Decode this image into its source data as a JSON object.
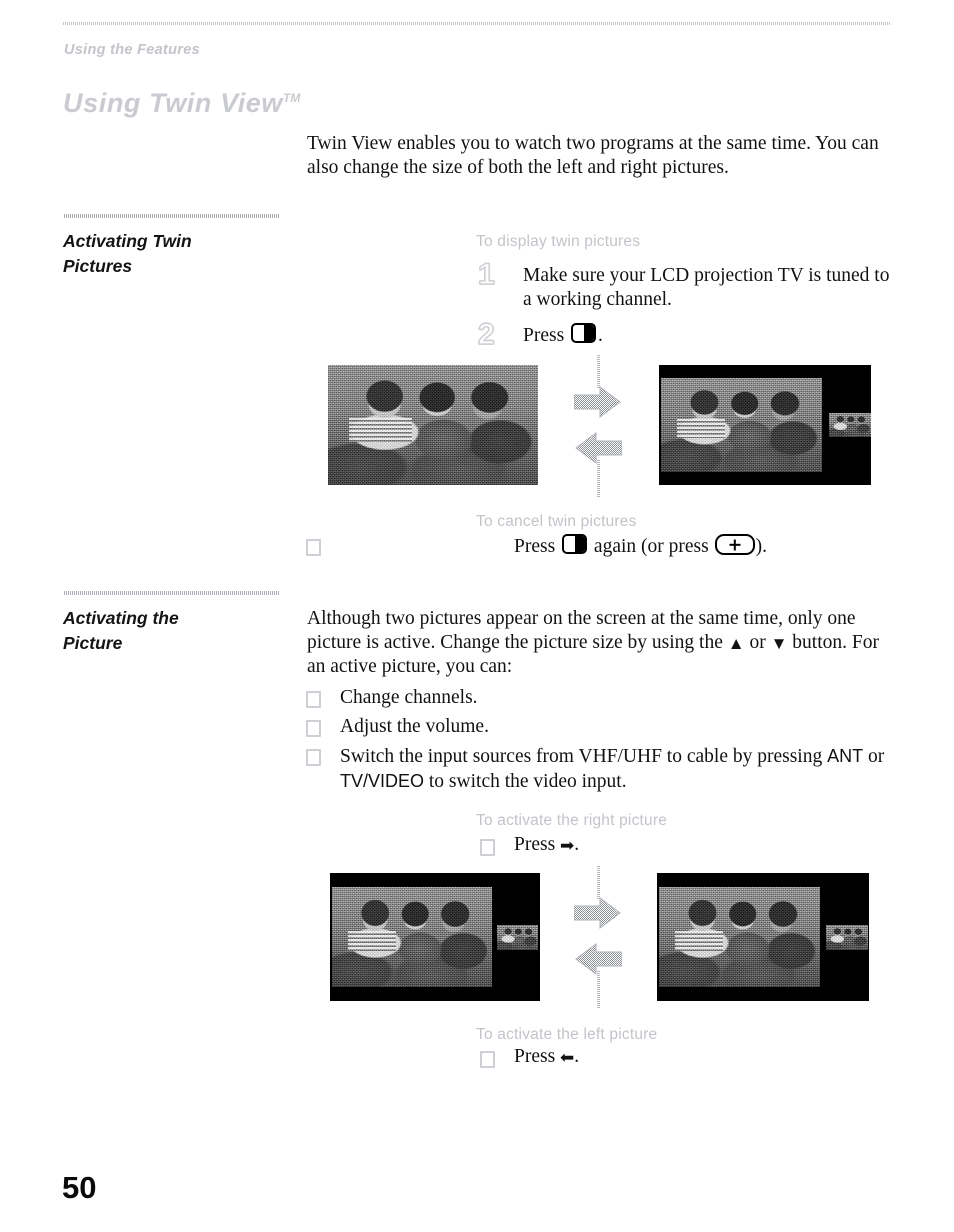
{
  "header": {
    "running_head": "Using the Features",
    "chapter_title": "Using Twin View",
    "trademark": "TM"
  },
  "intro": {
    "paragraph": "Twin View enables you to watch two programs at the same time. You can also change the size of both the left and right pictures."
  },
  "sections": [
    {
      "label_line1": "Activating Twin",
      "label_line2": "Pictures",
      "subhead_display": "To display twin pictures",
      "steps": [
        {
          "number": "1",
          "text": "Make sure your LCD projection TV is tuned to a working channel."
        },
        {
          "number": "2",
          "text_before": "Press",
          "text_after": "."
        }
      ],
      "subhead_cancel": "To cancel twin pictures",
      "cancel_bullet": {
        "text_before": "Press",
        "text_middle": "again (or press",
        "text_after": ")."
      }
    },
    {
      "label_line1": "Activating the",
      "label_line2": "Picture",
      "paragraph_1": "Although two pictures appear on the screen at the same time, only one",
      "paragraph_2_a": "picture is active. Change the picture size by using the",
      "paragraph_2_or": "or",
      "paragraph_2_b": "button. For an",
      "paragraph_3": "active picture, you can:",
      "bullets": [
        {
          "text": "Change channels."
        },
        {
          "text": "Adjust the volume."
        }
      ],
      "bullet_switch": {
        "part_1": "Switch the input sources from VHF/UHF to cable by pressing",
        "ant": "ANT",
        "part_2": "or",
        "tvvideo": "TV/VIDEO",
        "part_3": "to switch the video input."
      },
      "subhead_right": "To activate the right picture",
      "right_bullet_before": "Press",
      "right_bullet_after": ".",
      "subhead_left": "To activate the left picture",
      "left_bullet_before": "Press",
      "left_bullet_after": "."
    }
  ],
  "icons": {
    "twin_view_button": "twin-view-button-icon",
    "plus_button": "plus-button-icon",
    "arrow_up": "▲",
    "arrow_down": "▼",
    "arrow_right": "➡",
    "arrow_left": "⬅",
    "bullet": "square-bullet-icon"
  },
  "figures": {
    "figure_1_caption": "twin-view-activation-diagram",
    "figure_2_caption": "picture-activation-diagram"
  },
  "footer": {
    "page_number": "50"
  },
  "colors": {
    "gray_faded": "#c3c5ca",
    "text_black": "#121212",
    "rule_gray": "#b9bcc4"
  }
}
